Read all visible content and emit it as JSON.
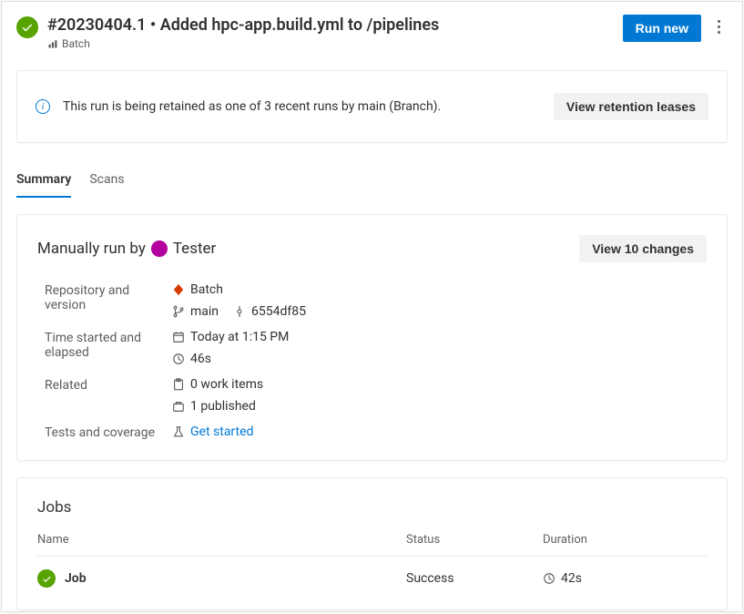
{
  "header": {
    "title": "#20230404.1 • Added hpc-app.build.yml to /pipelines",
    "project": "Batch",
    "run_new_label": "Run new"
  },
  "banner": {
    "text": "This run is being retained as one of 3 recent runs by main (Branch).",
    "view_leases_label": "View retention leases"
  },
  "tabs": {
    "summary": "Summary",
    "scans": "Scans"
  },
  "run_card": {
    "run_by_prefix": "Manually run by",
    "runner_name": "Tester",
    "view_changes_label": "View 10 changes",
    "kv": {
      "repo_key": "Repository and version",
      "repo_name": "Batch",
      "branch": "main",
      "commit": "6554df85",
      "time_key": "Time started and elapsed",
      "time_started": "Today at 1:15 PM",
      "elapsed": "46s",
      "related_key": "Related",
      "work_items": "0 work items",
      "published": "1 published",
      "tests_key": "Tests and coverage",
      "get_started": "Get started"
    }
  },
  "jobs": {
    "title": "Jobs",
    "col_name": "Name",
    "col_status": "Status",
    "col_duration": "Duration",
    "rows": [
      {
        "name": "Job",
        "status": "Success",
        "duration": "42s"
      }
    ]
  }
}
